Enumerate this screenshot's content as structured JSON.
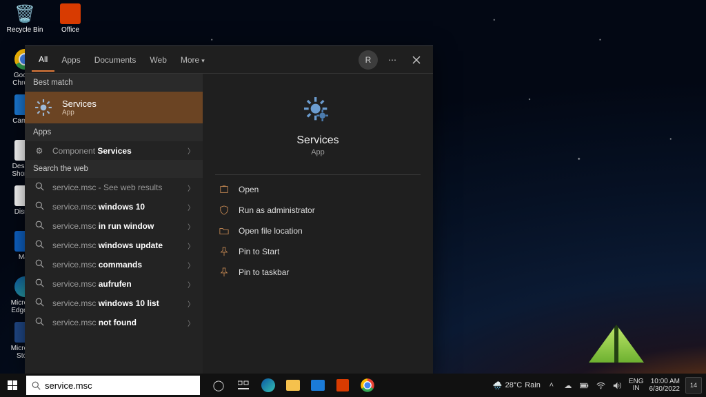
{
  "desktop": {
    "icons_left": [
      {
        "name": "recycle-bin",
        "label": "Recycle Bin"
      },
      {
        "name": "google-chrome",
        "label": "Google Chrome"
      },
      {
        "name": "camera",
        "label": "Camera"
      },
      {
        "name": "desktop-shortcut",
        "label": "Desktop Shortcut"
      },
      {
        "name": "disney",
        "label": "Disney"
      },
      {
        "name": "mail",
        "label": "Mail"
      },
      {
        "name": "microsoft-edge",
        "label": "Microsoft Edge (…"
      },
      {
        "name": "microsoft-store",
        "label": "Microsoft Store"
      }
    ],
    "office": {
      "label": "Office"
    }
  },
  "start": {
    "tabs": {
      "all": "All",
      "apps": "Apps",
      "documents": "Documents",
      "web": "Web",
      "more": "More"
    },
    "avatar_initial": "R",
    "best_match_header": "Best match",
    "best_match": {
      "title": "Services",
      "subtitle": "App"
    },
    "apps_header": "Apps",
    "component_services": "Component Services",
    "search_web_header": "Search the web",
    "web_results": [
      {
        "prefix": "service.msc",
        "bold": "",
        "suffix": " - See web results"
      },
      {
        "prefix": "service.msc ",
        "bold": "windows 10",
        "suffix": ""
      },
      {
        "prefix": "service.msc ",
        "bold": "in run window",
        "suffix": ""
      },
      {
        "prefix": "service.msc ",
        "bold": "windows update",
        "suffix": ""
      },
      {
        "prefix": "service.msc ",
        "bold": "commands",
        "suffix": ""
      },
      {
        "prefix": "service.msc ",
        "bold": "aufrufen",
        "suffix": ""
      },
      {
        "prefix": "service.msc ",
        "bold": "windows 10 list",
        "suffix": ""
      },
      {
        "prefix": "service.msc ",
        "bold": "not found",
        "suffix": ""
      }
    ],
    "detail": {
      "title": "Services",
      "subtitle": "App",
      "actions": [
        "Open",
        "Run as administrator",
        "Open file location",
        "Pin to Start",
        "Pin to taskbar"
      ]
    }
  },
  "taskbar": {
    "search_value": "service.msc",
    "weather": {
      "temp": "28°C",
      "cond": "Rain"
    },
    "lang": {
      "l1": "ENG",
      "l2": "IN"
    },
    "clock": {
      "time": "10:00 AM",
      "date": "6/30/2022"
    },
    "notif": "14"
  },
  "colors": {
    "accent": "#e07a3a",
    "panel": "#1f1f1f",
    "bestmatch": "#6b4423"
  }
}
